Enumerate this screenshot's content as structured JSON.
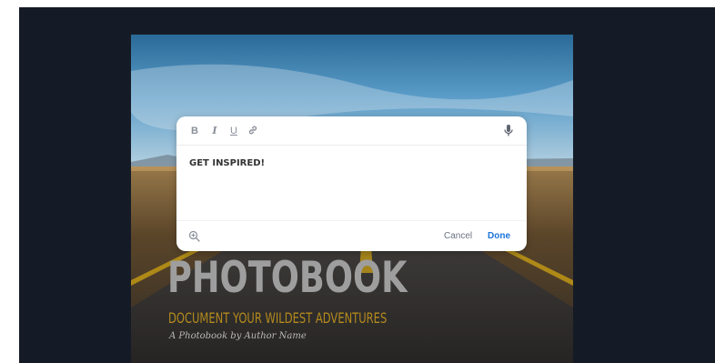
{
  "editor": {
    "toolbar": {
      "bold": "B",
      "italic": "I",
      "underline": "U",
      "link_icon": "link-icon",
      "mic_icon": "microphone-icon"
    },
    "text": "GET INSPIRED!",
    "footer": {
      "zoom_icon": "zoom-in-icon",
      "cancel_label": "Cancel",
      "done_label": "Done"
    }
  },
  "cover": {
    "title": "PHOTOBOOK",
    "subtitle": "DOCUMENT YOUR WILDEST ADVENTURES",
    "author": "A Photobook by Author Name"
  },
  "colors": {
    "workspace_bg": "#151b26",
    "accent_blue": "#1a73d9",
    "subtitle_gold": "#b58a1d",
    "road_line_yellow": "#e2b21c"
  }
}
